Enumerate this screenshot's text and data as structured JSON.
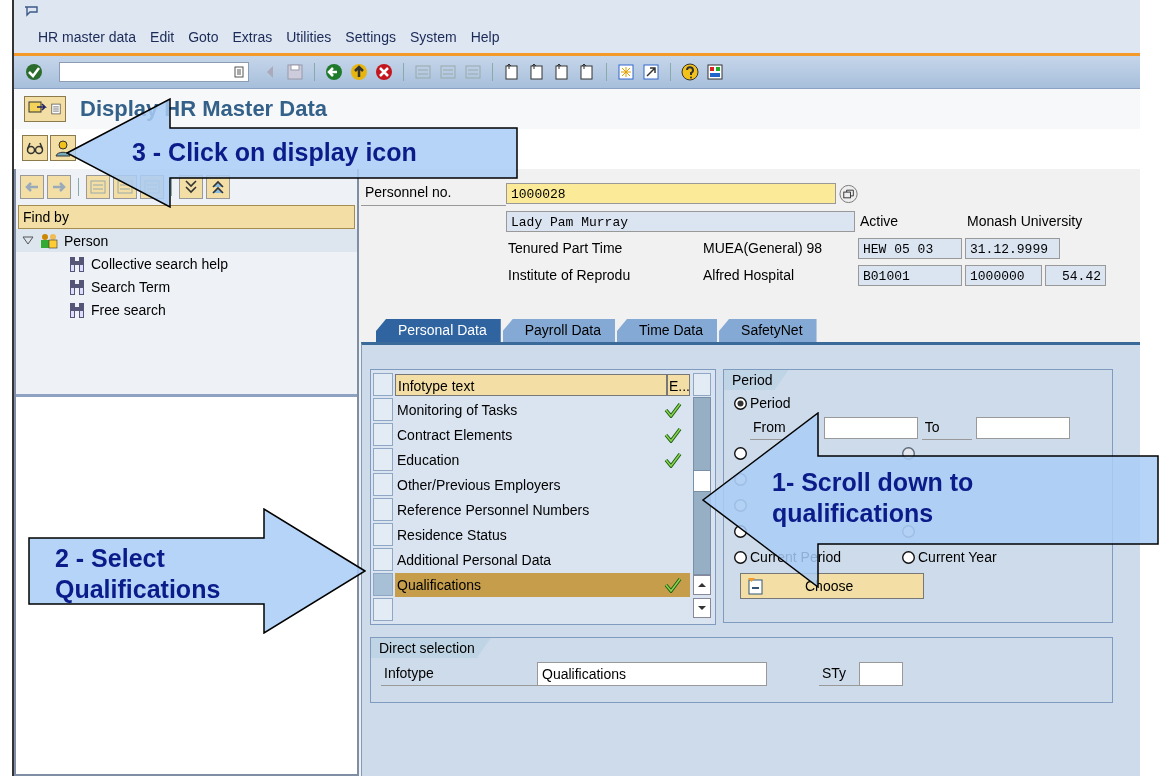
{
  "menu_bar": {
    "items": [
      "HR master data",
      "Edit",
      "Goto",
      "Extras",
      "Utilities",
      "Settings",
      "System",
      "Help"
    ]
  },
  "title": "Display HR Master Data",
  "find_panel": {
    "header": "Find by",
    "tree": [
      {
        "label": "Person",
        "expanded": true,
        "children": [
          {
            "label": "Collective search help"
          },
          {
            "label": "Search Term"
          },
          {
            "label": "Free search"
          }
        ]
      }
    ]
  },
  "header": {
    "personnel_no_label": "Personnel no.",
    "personnel_no": "1000028",
    "name": "Lady Pam Murray",
    "status": "Active",
    "organization": "Monash University",
    "row_1": {
      "text_1": "Tenured Part Time",
      "text_2": "MUEA(General) 98",
      "box_1": "HEW 05 03",
      "box_2": "31.12.9999"
    },
    "row_2": {
      "text_1": "Institute of Reprodu",
      "text_2": "Alfred Hospital",
      "box_1": "B01001",
      "box_2": "1000000",
      "box_3": "54.42"
    }
  },
  "tabs": [
    {
      "label": "Personal Data",
      "selected": true
    },
    {
      "label": "Payroll Data",
      "selected": false
    },
    {
      "label": "Time Data",
      "selected": false
    },
    {
      "label": "SafetyNet",
      "selected": false
    }
  ],
  "infotype_table": {
    "columns": [
      "Infotype text",
      "E..."
    ],
    "rows": [
      {
        "text": "Monitoring of Tasks",
        "exists": true,
        "selected": false
      },
      {
        "text": "Contract Elements",
        "exists": true,
        "selected": false
      },
      {
        "text": "Education",
        "exists": true,
        "selected": false
      },
      {
        "text": "Other/Previous Employers",
        "exists": false,
        "selected": false
      },
      {
        "text": "Reference Personnel Numbers",
        "exists": false,
        "selected": false
      },
      {
        "text": "Residence Status",
        "exists": false,
        "selected": false
      },
      {
        "text": "Additional Personal Data",
        "exists": false,
        "selected": false
      },
      {
        "text": "Qualifications",
        "exists": true,
        "selected": true
      }
    ]
  },
  "period": {
    "title": "Period",
    "period_option": {
      "label": "Period",
      "selected": true
    },
    "from_label": "From",
    "to_label": "To",
    "options": [
      {
        "selected": false,
        "disabled": false
      },
      {
        "selected": false,
        "disabled": true
      },
      {
        "selected": false,
        "disabled": true
      },
      {
        "selected": false,
        "disabled": true
      },
      {
        "selected": false,
        "disabled": false
      },
      {
        "selected": false,
        "disabled": true
      },
      {
        "label": "Current Period",
        "selected": false,
        "disabled": false
      },
      {
        "label": "Current Year",
        "selected": false,
        "disabled": false
      }
    ],
    "choose_button": "Choose"
  },
  "direct_selection": {
    "title": "Direct selection",
    "infotype_label": "Infotype",
    "infotype_value": "Qualifications",
    "subtype_label": "STy"
  },
  "callouts": [
    {
      "text": "3 - Click on display icon"
    },
    {
      "text": "2 - Select Qualifications"
    },
    {
      "text": "1- Scroll down to qualifications"
    }
  ]
}
